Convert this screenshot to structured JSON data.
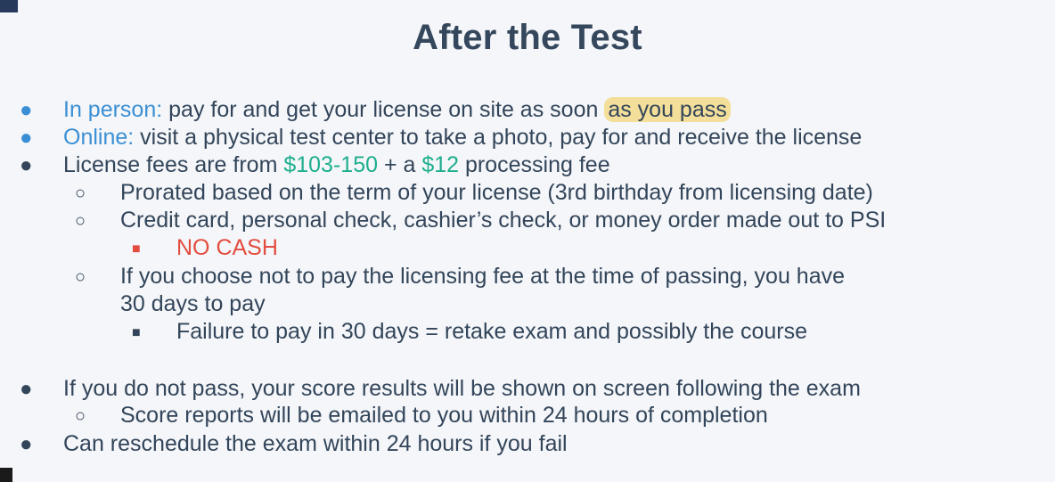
{
  "title": "After the Test",
  "items": {
    "in_person_label": "In person:",
    "in_person_text": " pay for and get your license on site as soon",
    "in_person_highlight": "as you pass",
    "online_label": "Online:",
    "online_text": " visit a physical test center to take a photo, pay for and receive the license",
    "fees_prefix": "License fees are from ",
    "fees_range": "$103-150",
    "fees_mid": " + a ",
    "fees_processing": "$12",
    "fees_suffix": " processing fee",
    "prorated": "Prorated based on the term of your license (3rd birthday from licensing date)",
    "payment_methods": "Credit card, personal check, cashier’s check, or money order made out to PSI",
    "no_cash": "NO CASH",
    "choose_not_line1": "If you choose not to pay the licensing fee at the time of passing, you have",
    "choose_not_line2": "30 days to pay",
    "failure_to_pay": "Failure to pay in 30 days = retake exam and possibly the course",
    "not_pass": "If you do not pass, your score results will be shown on screen following the exam",
    "score_reports": "Score reports will be emailed to you within 24 hours of completion",
    "reschedule": "Can reschedule the exam within 24 hours if you fail"
  },
  "bullets": {
    "dot": "●",
    "circle": "○",
    "square": "■"
  },
  "colors": {
    "blue_label": "#3b8fd4",
    "green_money": "#1fae8e",
    "red_warning": "#e34d3f",
    "highlight": "#f3df9a",
    "text": "#33455a"
  }
}
